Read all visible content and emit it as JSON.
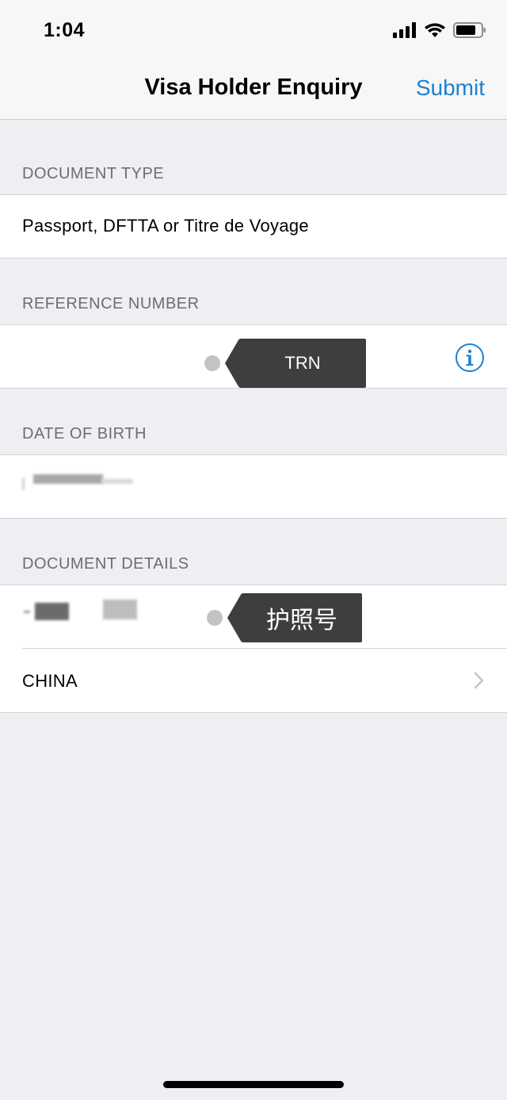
{
  "status_bar": {
    "time": "1:04"
  },
  "nav": {
    "title": "Visa Holder Enquiry",
    "submit_label": "Submit"
  },
  "sections": {
    "document_type": {
      "header": "DOCUMENT TYPE",
      "value": "Passport, DFTTA or Titre de Voyage"
    },
    "reference_number": {
      "header": "REFERENCE NUMBER",
      "tooltip": "TRN"
    },
    "date_of_birth": {
      "header": "DATE OF BIRTH"
    },
    "document_details": {
      "header": "DOCUMENT DETAILS",
      "tooltip": "护照号",
      "country": "CHINA"
    }
  },
  "colors": {
    "accent": "#1a82d3",
    "tooltip_bg": "#3e3d40",
    "background": "#efeef3"
  },
  "icons": [
    "signal-icon",
    "wifi-icon",
    "battery-icon",
    "info-icon",
    "chevron-right-icon"
  ]
}
